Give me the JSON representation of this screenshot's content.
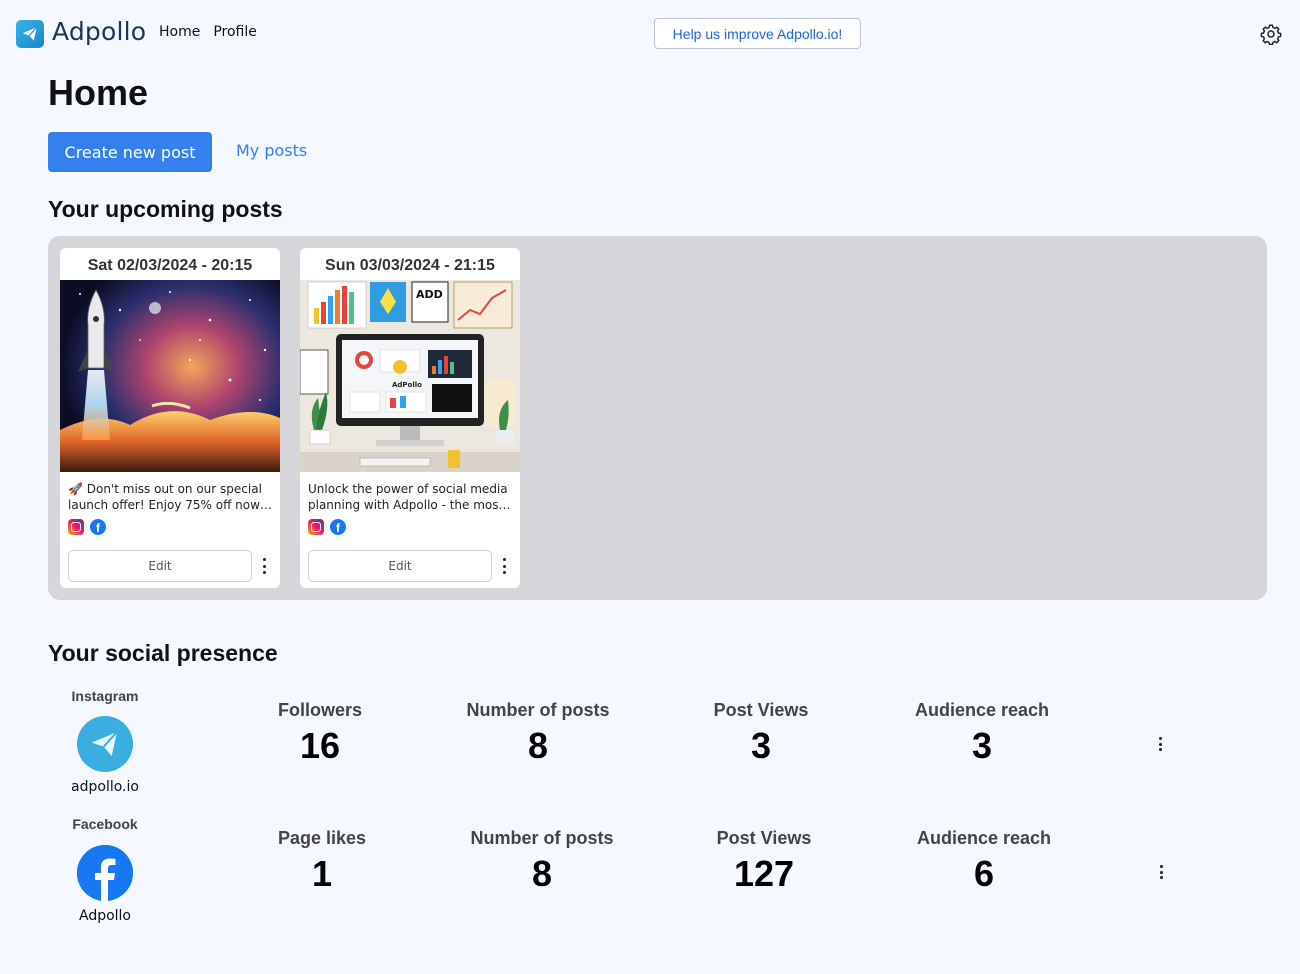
{
  "header": {
    "brand": "Adpollo",
    "nav": [
      "Home",
      "Profile"
    ],
    "help_button": "Help us improve Adpollo.io!",
    "settings_icon": "gear-icon"
  },
  "page": {
    "title": "Home",
    "create_button": "Create new post",
    "my_posts_link": "My posts"
  },
  "upcoming": {
    "title": "Your upcoming posts",
    "posts": [
      {
        "date": "Sat 02/03/2024 - 20:15",
        "text_line1": "🚀 Don't miss out on our special",
        "text_line2": "launch offer! Enjoy 75% off now …",
        "image": "rocket-launch-image",
        "platforms": [
          "instagram",
          "facebook"
        ],
        "edit_label": "Edit"
      },
      {
        "date": "Sun 03/03/2024 - 21:15",
        "text_line1": "Unlock the power of social media",
        "text_line2": "planning with Adpollo - the most…",
        "image": "dashboard-workspace-image",
        "platforms": [
          "instagram",
          "facebook"
        ],
        "edit_label": "Edit"
      }
    ]
  },
  "social": {
    "title": "Your social presence",
    "accounts": [
      {
        "platform": "Instagram",
        "handle": "adpollo.io",
        "avatar_icon": "paper-plane-icon",
        "avatar_color": "#3aaee0",
        "stats": [
          {
            "label": "Followers",
            "value": "16"
          },
          {
            "label": "Number of posts",
            "value": "8"
          },
          {
            "label": "Post Views",
            "value": "3"
          },
          {
            "label": "Audience reach",
            "value": "3"
          }
        ]
      },
      {
        "platform": "Facebook",
        "handle": "Adpollo",
        "avatar_icon": "facebook-icon",
        "avatar_color": "#1877f2",
        "stats": [
          {
            "label": "Page likes",
            "value": "1"
          },
          {
            "label": "Number of posts",
            "value": "8"
          },
          {
            "label": "Post Views",
            "value": "127"
          },
          {
            "label": "Audience reach",
            "value": "6"
          }
        ]
      }
    ]
  },
  "colors": {
    "accent": "#3580ec",
    "background": "#f5f9ff",
    "panel": "#d6d5da",
    "brand_text": "#16365b"
  }
}
